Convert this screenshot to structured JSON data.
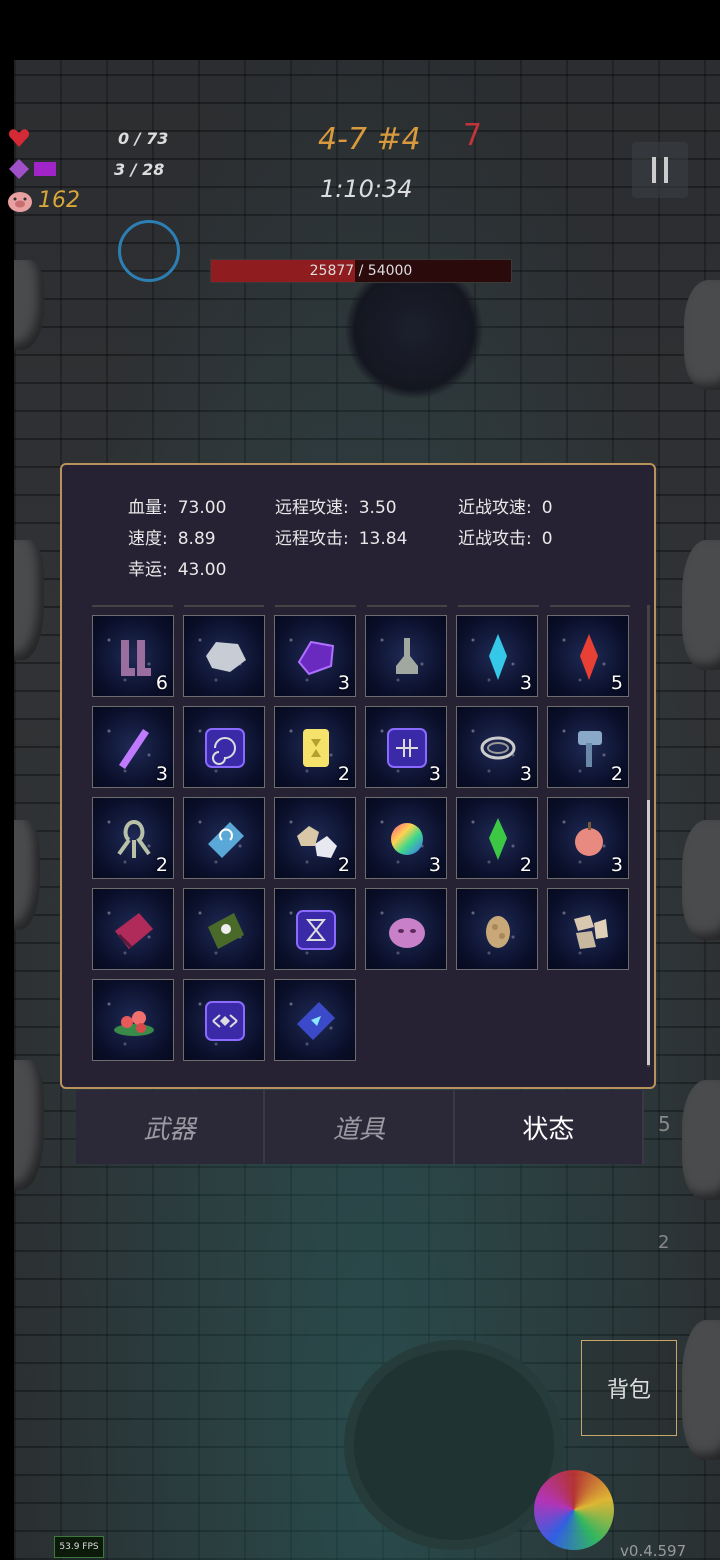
{
  "hud": {
    "health": "0 / 73",
    "mana": "3 / 28",
    "coins": "162",
    "stage": "4-7 #4",
    "stage_count": "7",
    "timer": "1:10:34"
  },
  "boss": {
    "hp_text": "25877 / 54000",
    "hp_fraction": 0.479
  },
  "stats": [
    {
      "label": "血量:",
      "value": "73.00"
    },
    {
      "label": "远程攻速:",
      "value": "3.50"
    },
    {
      "label": "近战攻速:",
      "value": "0"
    },
    {
      "label": "速度:",
      "value": "8.89"
    },
    {
      "label": "远程攻击:",
      "value": "13.84"
    },
    {
      "label": "近战攻击:",
      "value": "0"
    },
    {
      "label": "幸运:",
      "value": "43.00"
    }
  ],
  "items": [
    {
      "icon": "boots-icon",
      "count": "6"
    },
    {
      "icon": "silver-ore-icon",
      "count": ""
    },
    {
      "icon": "purple-crystal-icon",
      "count": "3"
    },
    {
      "icon": "potion-bottle-icon",
      "count": ""
    },
    {
      "icon": "blue-crystal-icon",
      "count": "3"
    },
    {
      "icon": "red-crystal-icon",
      "count": "5"
    },
    {
      "icon": "purple-rod-icon",
      "count": "3"
    },
    {
      "icon": "spiral-rune-icon",
      "count": ""
    },
    {
      "icon": "yellow-card-icon",
      "count": "2"
    },
    {
      "icon": "cross-rune-icon",
      "count": "3"
    },
    {
      "icon": "ring-icon",
      "count": "3"
    },
    {
      "icon": "hammer-icon",
      "count": "2"
    },
    {
      "icon": "squid-icon",
      "count": "2"
    },
    {
      "icon": "blue-book-icon",
      "count": ""
    },
    {
      "icon": "stones-icon",
      "count": "2"
    },
    {
      "icon": "rainbow-orb-icon",
      "count": "3"
    },
    {
      "icon": "green-crystal-icon",
      "count": "2"
    },
    {
      "icon": "apple-icon",
      "count": "3"
    },
    {
      "icon": "red-book-icon",
      "count": ""
    },
    {
      "icon": "green-book-icon",
      "count": ""
    },
    {
      "icon": "hourglass-rune-icon",
      "count": ""
    },
    {
      "icon": "pink-slime-icon",
      "count": ""
    },
    {
      "icon": "egg-icon",
      "count": ""
    },
    {
      "icon": "bone-pile-icon",
      "count": ""
    },
    {
      "icon": "flower-icon",
      "count": ""
    },
    {
      "icon": "eye-rune-icon",
      "count": ""
    },
    {
      "icon": "magic-book-icon",
      "count": ""
    }
  ],
  "tabs": [
    {
      "label": "武器",
      "active": false
    },
    {
      "label": "道具",
      "active": false
    },
    {
      "label": "状态",
      "active": true
    }
  ],
  "bag_label": "背包",
  "fps": "53.9 FPS",
  "version": "v0.4.597",
  "side_counts": {
    "top": "5",
    "bottom": "2"
  },
  "colors": {
    "panel_border": "#b8925a",
    "boss_bar": "#8f1d1f",
    "stage": "#d89a3c"
  }
}
